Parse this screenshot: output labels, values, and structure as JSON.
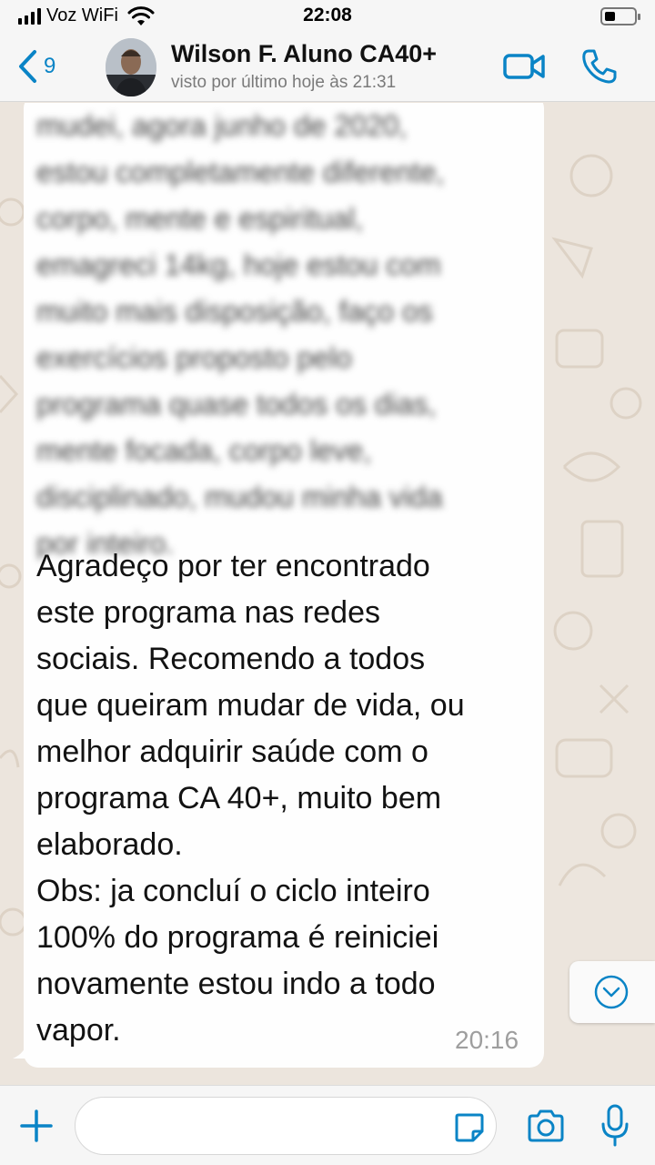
{
  "status_bar": {
    "carrier": "Voz WiFi",
    "time": "22:08"
  },
  "header": {
    "back_count": "9",
    "contact_name": "Wilson F. Aluno CA40+",
    "contact_status": "visto por último hoje às 21:31"
  },
  "message": {
    "blurred_lines": [
      "mudei, agora junho de 2020,",
      "estou completamente diferente,",
      "corpo, mente e espiritual,",
      "emagreci 14kg, hoje estou com",
      "muito mais disposição, faço os",
      "exercícios proposto pelo",
      "programa quase todos os dias,",
      "mente focada, corpo leve,",
      "disciplinado, mudou minha vida",
      "por inteiro."
    ],
    "lines": [
      "Agradeço por ter encontrado",
      "este programa nas redes",
      "sociais. Recomendo a todos",
      "que queiram mudar de vida, ou",
      "melhor adquirir saúde com o",
      "programa CA 40+, muito bem",
      "elaborado.",
      "Obs: ja concluí o ciclo inteiro",
      "100% do programa é reiniciei",
      "novamente estou indo a todo",
      "vapor."
    ],
    "time": "20:16"
  },
  "input": {
    "placeholder": ""
  },
  "colors": {
    "accent": "#0a84c6",
    "chat_background": "#ece5dd",
    "bubble": "#fefefe",
    "bar_background": "#f6f6f6"
  },
  "icons": {
    "back": "chevron-left-icon",
    "video": "video-camera-icon",
    "call": "phone-icon",
    "plus": "plus-icon",
    "sticker": "sticker-icon",
    "camera": "camera-icon",
    "mic": "microphone-icon",
    "scroll": "chevron-down-circle-icon"
  }
}
